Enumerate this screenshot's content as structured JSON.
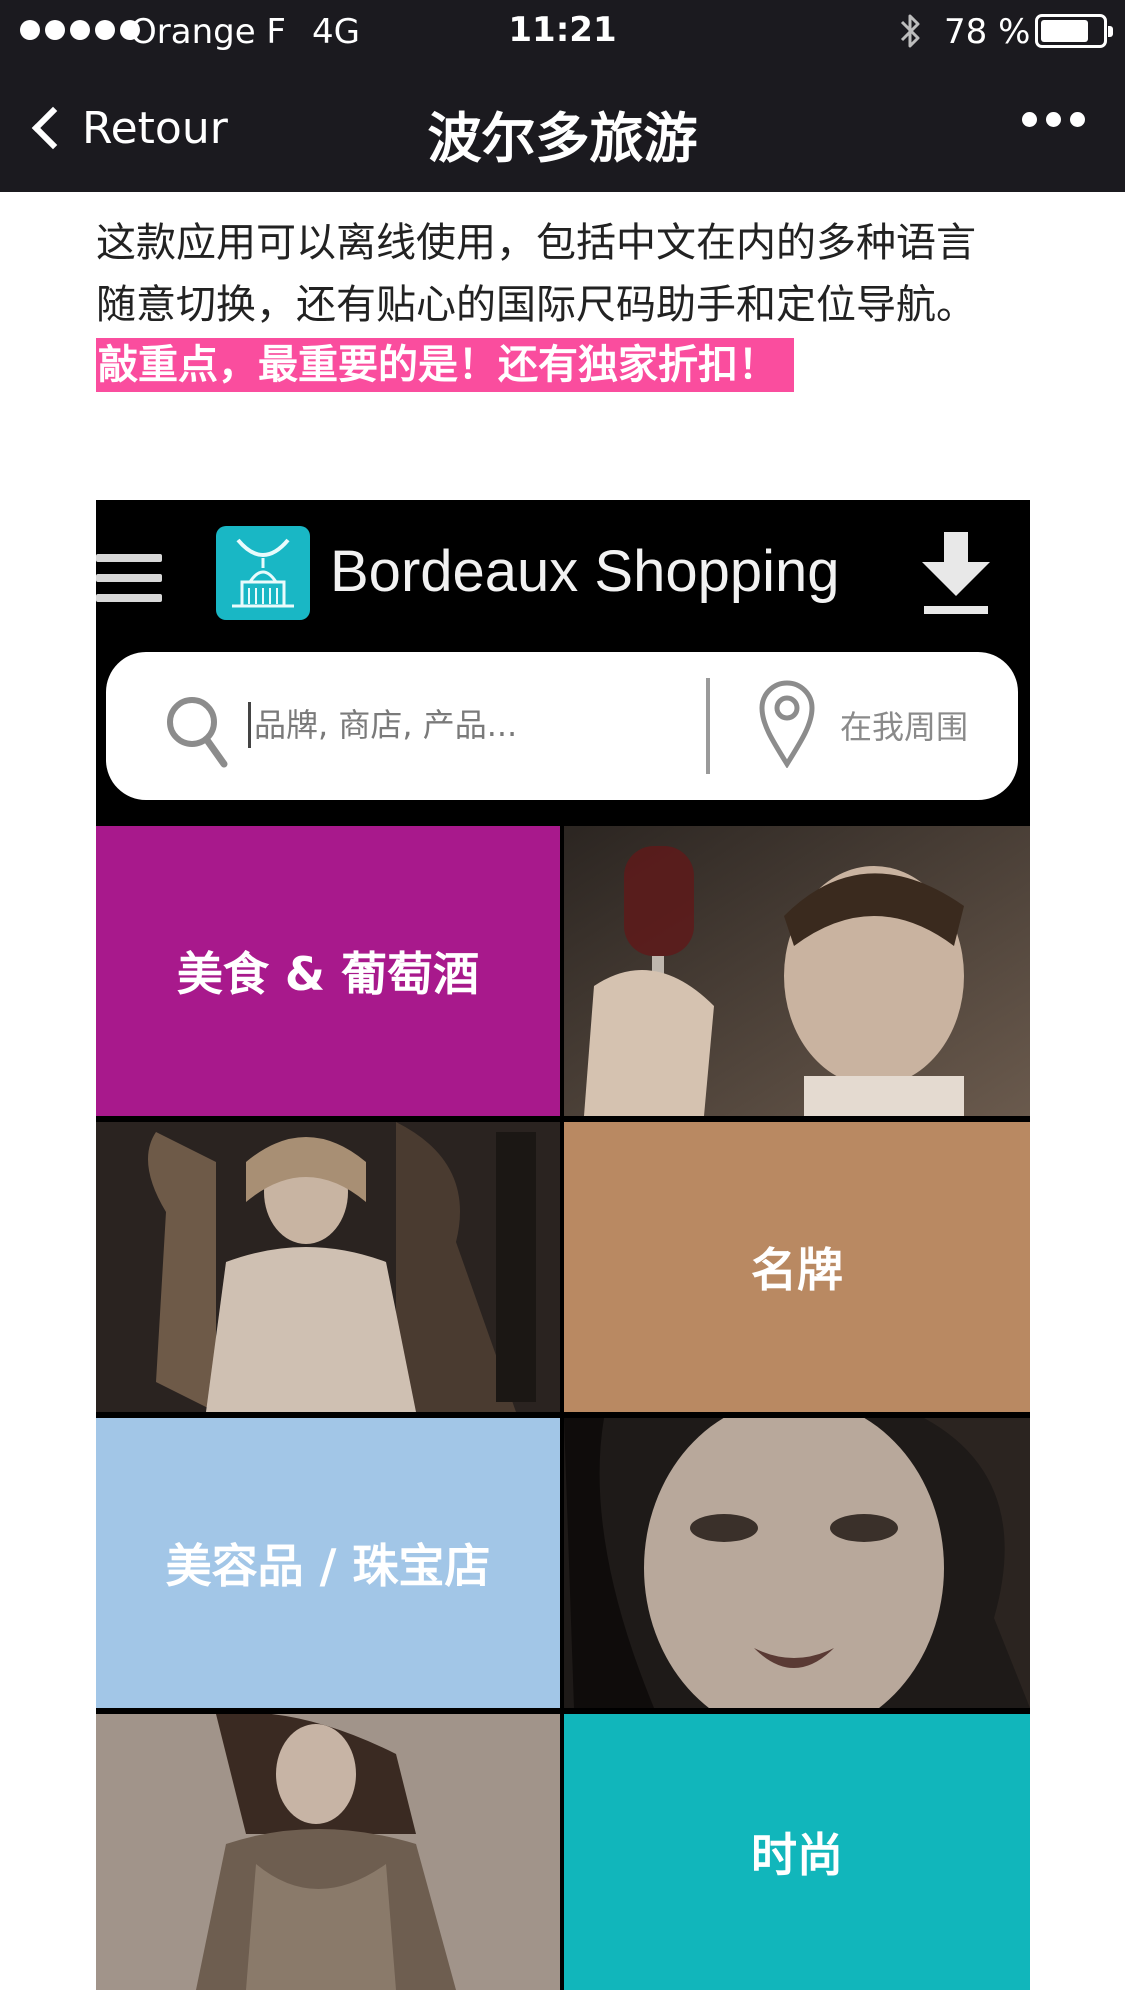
{
  "status_bar": {
    "carrier": "Orange F",
    "network": "4G",
    "time": "11:21",
    "battery_percent": "78 %",
    "battery_level": 0.78
  },
  "nav": {
    "back_label": "Retour",
    "title": "波尔多旅游"
  },
  "article": {
    "lines": [
      "这款应用可以离线使用，包括中文在内的多种语言",
      "随意切换，还有贴心的国际尺码助手和定位导航。"
    ],
    "highlight": "敲重点，最重要的是！还有独家折扣！"
  },
  "app_screenshot": {
    "app_name": "Bordeaux Shopping",
    "search_placeholder": "品牌, 商店, 产品...",
    "nearby_label": "在我周围",
    "categories": [
      {
        "label": "美食 & 葡萄酒",
        "color": "#a8198c"
      },
      {
        "label": "名牌",
        "color": "#b98962"
      },
      {
        "label": "美容品 / 珠宝店",
        "color": "#a2c6e7"
      },
      {
        "label": "时尚",
        "color": "#11b6bb"
      }
    ]
  }
}
